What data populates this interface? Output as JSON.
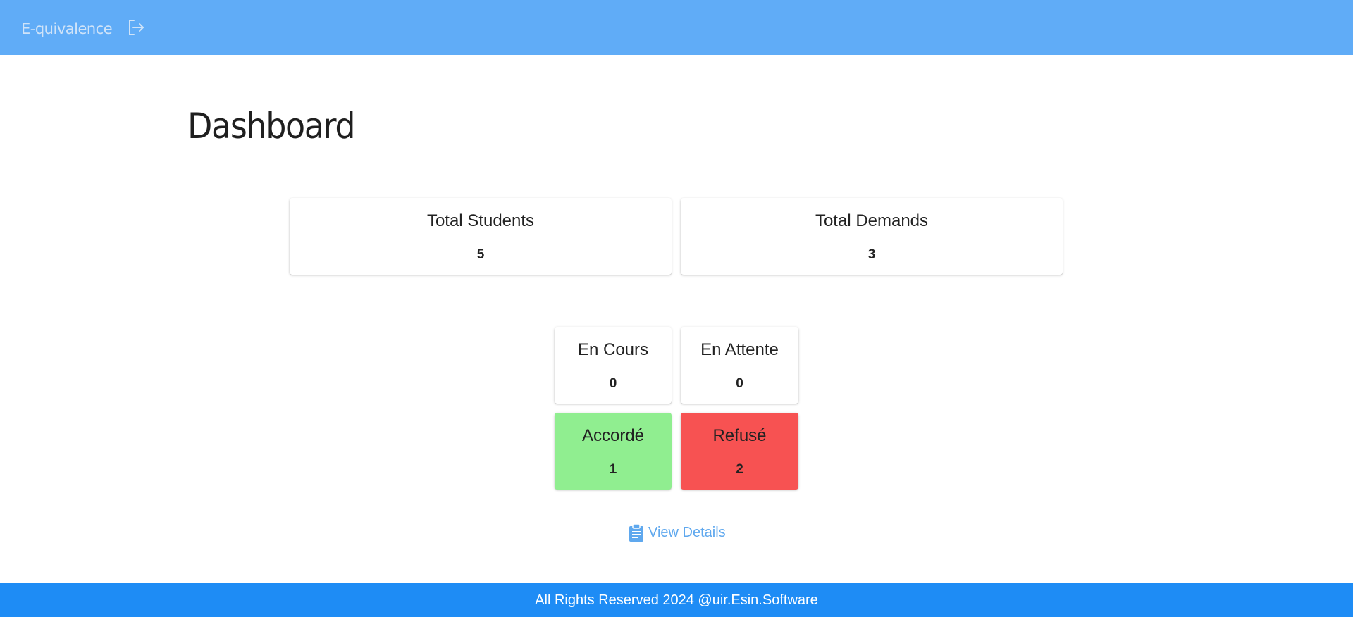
{
  "header": {
    "brand": "E-quivalence",
    "logout_icon": "logout-icon",
    "background_color": "#60acf7"
  },
  "main": {
    "title": "Dashboard"
  },
  "stats": {
    "total_students": {
      "label": "Total Students",
      "value": "5"
    },
    "total_demands": {
      "label": "Total Demands",
      "value": "3"
    }
  },
  "status_cards": {
    "en_cours": {
      "label": "En Cours",
      "value": "0"
    },
    "en_attente": {
      "label": "En Attente",
      "value": "0"
    },
    "accorde": {
      "label": "Accordé",
      "value": "1",
      "color": "#90ee90"
    },
    "refuse": {
      "label": "Refusé",
      "value": "2",
      "color": "#f75252"
    }
  },
  "actions": {
    "view_details_label": "View Details",
    "view_details_icon": "clipboard-icon",
    "link_color": "#5fa8ee"
  },
  "footer": {
    "text": "All Rights Reserved 2024 @uir.Esin.Software",
    "background_color": "#1e8cf5"
  }
}
